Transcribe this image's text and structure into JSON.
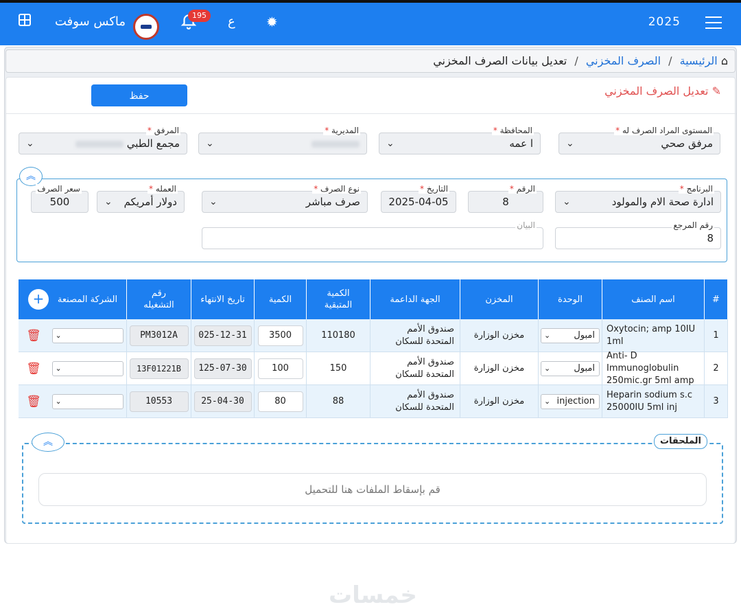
{
  "topbar": {
    "year": "2025",
    "app_name": "ماكس سوفت",
    "notifications_count": "195",
    "lang_label": "ع",
    "menu_icon": "hamburger-icon",
    "grid_icon": "grid-icon",
    "bell_icon": "bell-icon",
    "gear_icon": "gear-icon"
  },
  "breadcrumb": {
    "home": "الرئيسية",
    "section": "الصرف المخزني",
    "current": "تعديل بيانات الصرف المخزني"
  },
  "card": {
    "title": "تعديل الصرف المخزني",
    "save_label": "حفظ"
  },
  "filters": {
    "level_label": "المستوى المراد الصرف له",
    "level_value": "مرفق صحي",
    "governorate_label": "المحافظة",
    "governorate_value": "ا      عمه",
    "directorate_label": "المديرية",
    "directorate_value": "",
    "facility_label": "المرفق",
    "facility_value": "مجمع الطبي"
  },
  "details": {
    "program_label": "البرنامج",
    "program_value": "ادارة صحة الام والمولود",
    "number_label": "الرقم",
    "number_value": "8",
    "date_label": "التاريخ",
    "date_value": "2025-04-05",
    "type_label": "نوع الصرف",
    "type_value": "صرف مباشر",
    "currency_label": "العمله",
    "currency_value": "دولار أمريكم",
    "rate_label": "سعر الصرف",
    "rate_value": "500",
    "ref_label": "رقم المرجع",
    "ref_value": "8",
    "note_label": "البيان",
    "note_value": ""
  },
  "table": {
    "headers": {
      "num": "#",
      "item": "اسم الصنف",
      "unit": "الوحدة",
      "store": "المخزن",
      "donor": "الجهة الداعمة",
      "remaining": "الكمية المتبقية",
      "qty": "الكمية",
      "expiry": "تاريخ الانتهاء",
      "batch": "رقم التشغيله",
      "maker": "الشركة المصنعة"
    },
    "rows": [
      {
        "num": "1",
        "item": "Oxytocin; amp 10IU 1ml",
        "unit": "امبول",
        "store": "مخزن الوزارة",
        "donor": "صندوق الأمم المتحدة للسكان",
        "remaining": "110180",
        "qty": "3500",
        "expiry": "025-12-31",
        "batch": "PM3012A",
        "maker": ""
      },
      {
        "num": "2",
        "item": "Anti- D Immunoglobulin 250mic.gr 5ml amp",
        "unit": "امبول",
        "store": "مخزن الوزارة",
        "donor": "صندوق الأمم المتحدة للسكان",
        "remaining": "150",
        "qty": "100",
        "expiry": "125-07-30",
        "batch": "13F01221B",
        "maker": ""
      },
      {
        "num": "3",
        "item": "Heparin sodium s.c 25000IU 5ml inj",
        "unit": "injection",
        "store": "مخزن الوزارة",
        "donor": "صندوق الأمم المتحدة للسكان",
        "remaining": "88",
        "qty": "80",
        "expiry": "25-04-30",
        "batch": "10553",
        "maker": ""
      }
    ]
  },
  "attachments": {
    "title": "الملحقات",
    "drop_text": "قم بإسقاط الملفات هنا للتحميل"
  },
  "watermark": "خمسات",
  "colors": {
    "primary": "#1d7ff0",
    "danger": "#e53935",
    "row_bg": "#e8f3fc"
  }
}
